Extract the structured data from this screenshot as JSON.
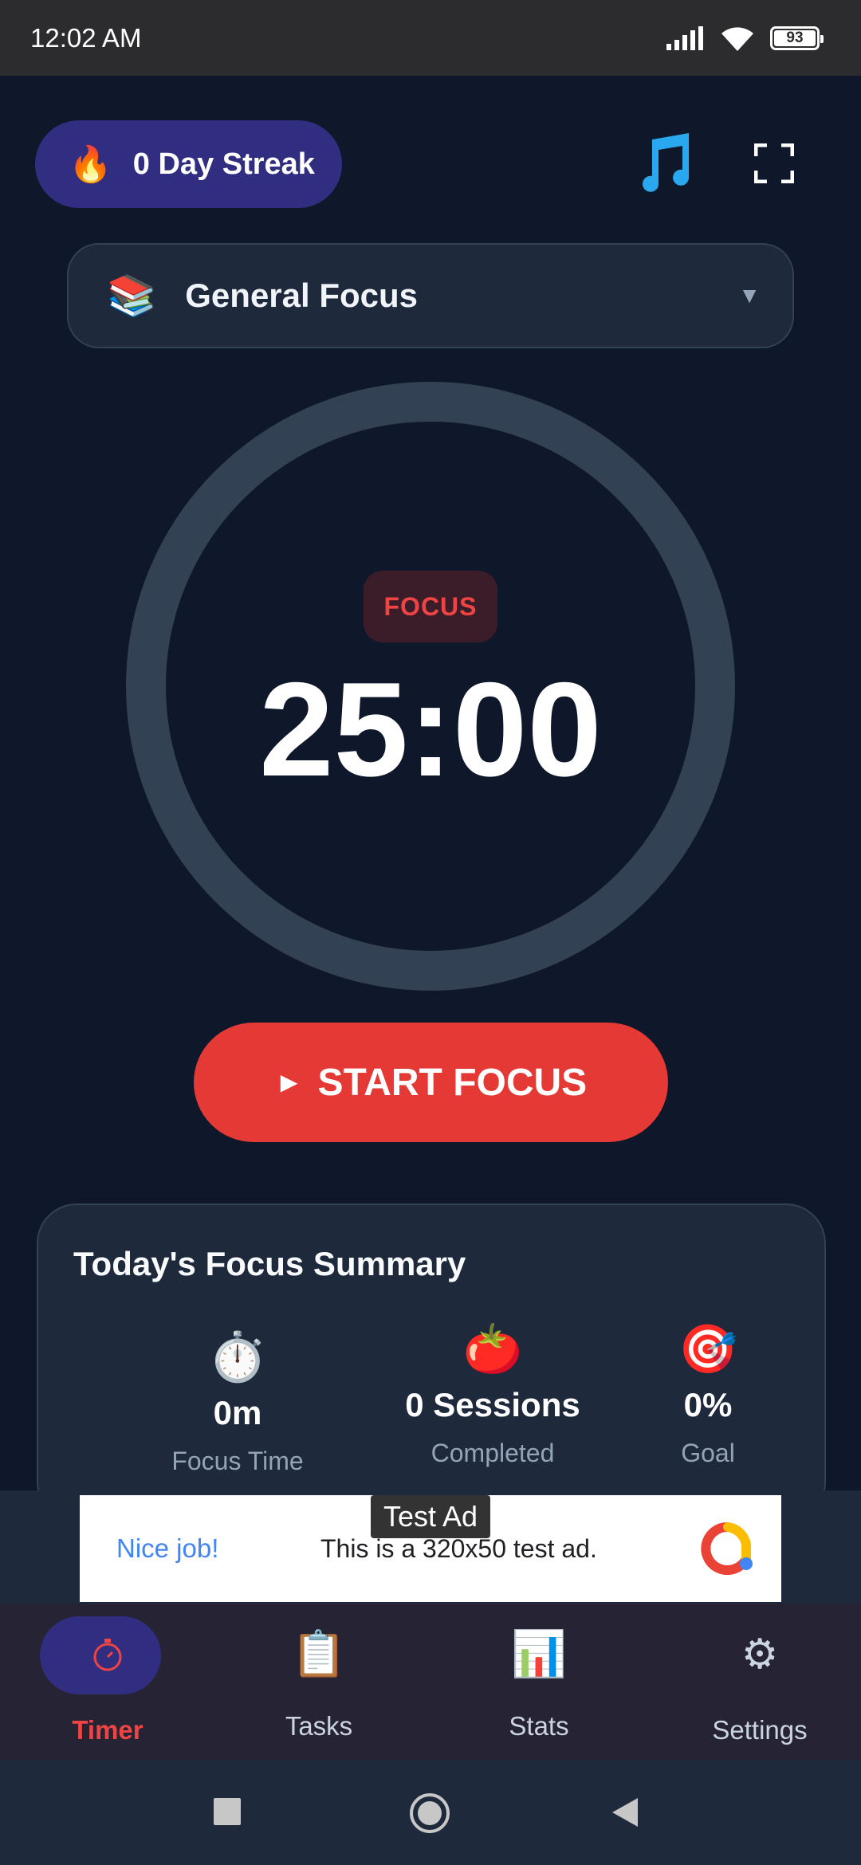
{
  "status_bar": {
    "time": "12:02 AM",
    "battery": "93"
  },
  "header": {
    "streak_label": "0 Day Streak",
    "streak_icon": "fire-icon",
    "music_icon": "music-note-icon",
    "fullscreen_icon": "fullscreen-icon"
  },
  "category": {
    "icon": "books-icon",
    "name": "General Focus",
    "chevron": "▼"
  },
  "timer": {
    "mode": "FOCUS",
    "time": "25:00",
    "progress": 0
  },
  "start_button": {
    "label": "START FOCUS",
    "icon": "►"
  },
  "summary": {
    "title": "Today's Focus Summary",
    "stats": [
      {
        "icon": "stopwatch-icon",
        "value": "0m",
        "caption": "Focus Time"
      },
      {
        "icon": "tomato-icon",
        "value": "0 Sessions",
        "caption": "Completed"
      },
      {
        "icon": "target-icon",
        "value": "0%",
        "caption": "Goal"
      }
    ]
  },
  "ad": {
    "tag": "Test Ad",
    "headline": "Nice job!",
    "message": "This is a 320x50 test ad."
  },
  "nav": {
    "items": [
      {
        "label": "Timer",
        "icon": "stopwatch-icon",
        "active": true
      },
      {
        "label": "Tasks",
        "icon": "clipboard-icon"
      },
      {
        "label": "Stats",
        "icon": "bar-chart-icon"
      },
      {
        "label": "Settings",
        "icon": "gear-icon"
      }
    ]
  },
  "colors": {
    "accent": "#e53935",
    "background": "#0f172a",
    "card": "#1e293b",
    "streak": "#312e81",
    "ring": "#334155"
  }
}
